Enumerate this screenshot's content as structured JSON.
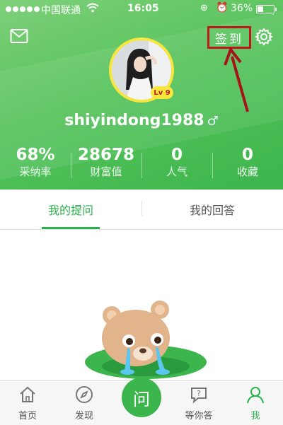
{
  "status_bar": {
    "carrier": "中国联通",
    "time": "16:05",
    "battery": "36%",
    "battery_level": 0.36
  },
  "header": {
    "checkin_label": "签到",
    "username": "shiyindong1988",
    "gender_symbol": "♂",
    "level": "Lv 9",
    "accent_color": "#3cb54c",
    "highlight_color": "#c0161c"
  },
  "stats": [
    {
      "value": "68%",
      "label": "采纳率"
    },
    {
      "value": "28678",
      "label": "财富值"
    },
    {
      "value": "0",
      "label": "人气"
    },
    {
      "value": "0",
      "label": "收藏"
    }
  ],
  "tabs": [
    {
      "label": "我的提问",
      "active": true
    },
    {
      "label": "我的回答",
      "active": false
    }
  ],
  "bottom_nav": [
    {
      "label": "首页",
      "icon": "home-icon"
    },
    {
      "label": "发现",
      "icon": "compass-icon"
    },
    {
      "label": "问",
      "icon": "ask-button"
    },
    {
      "label": "等你答",
      "icon": "question-bubble-icon"
    },
    {
      "label": "我",
      "icon": "person-icon",
      "active": true
    }
  ]
}
